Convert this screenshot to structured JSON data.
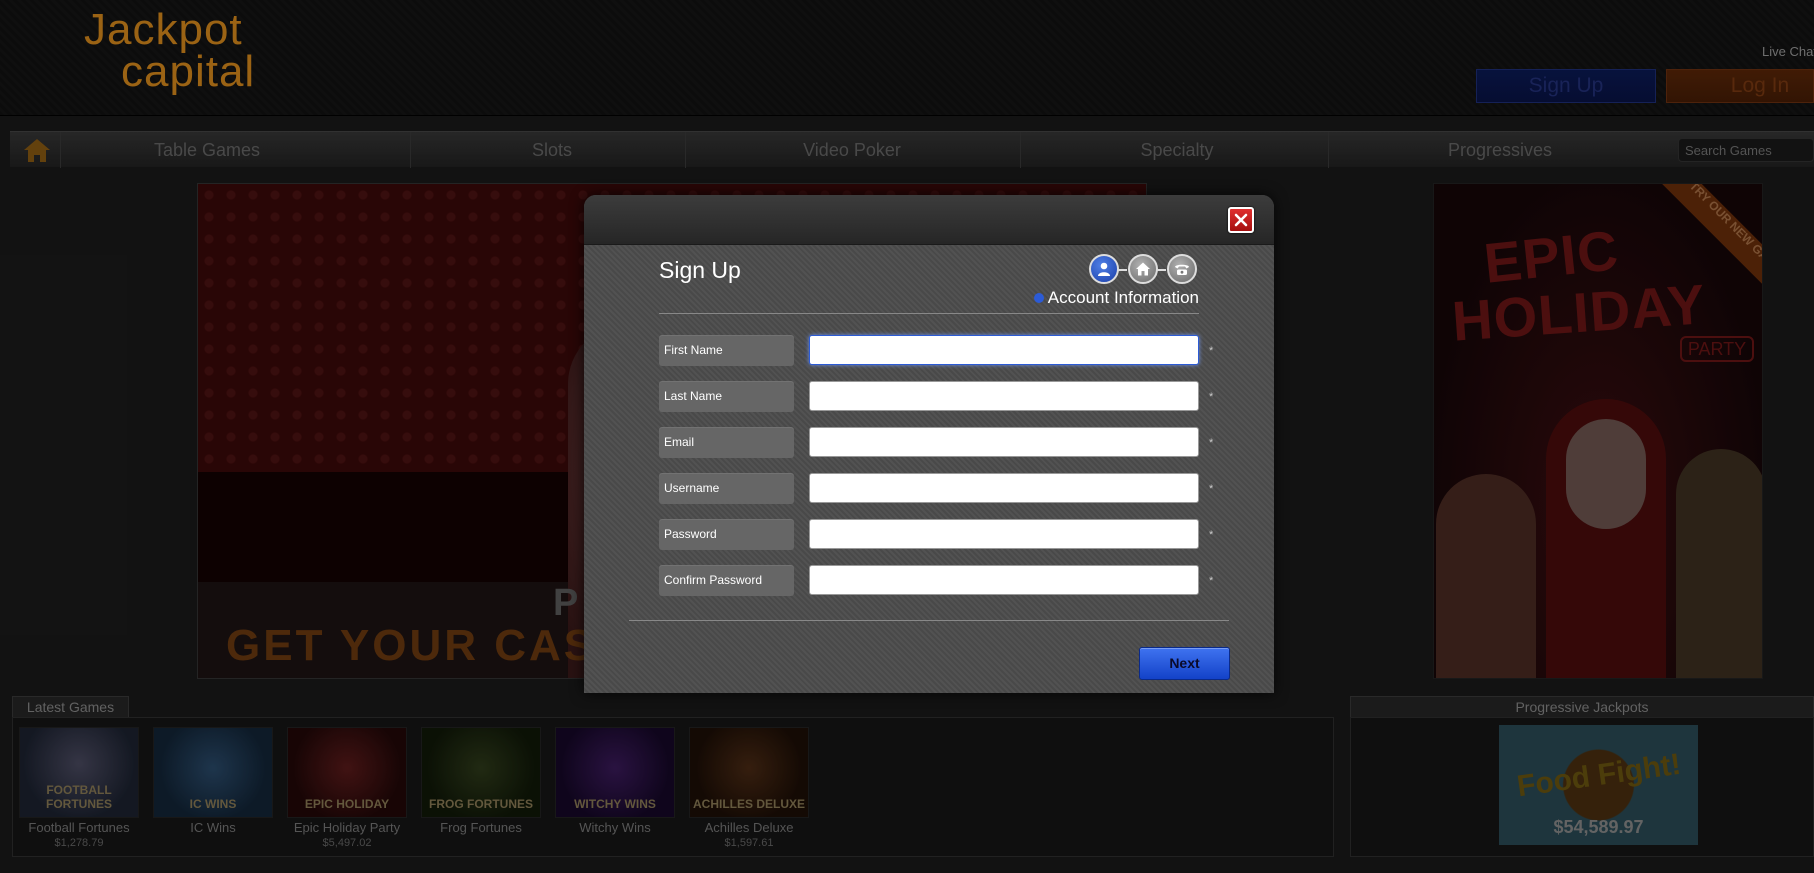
{
  "header": {
    "logo_line1": "Jackpot",
    "logo_line2": "capital",
    "live_chat": "Live Chat",
    "signup_label": "Sign Up",
    "login_label": "Log In"
  },
  "nav": {
    "items": [
      "Table Games",
      "Slots",
      "Video Poker",
      "Specialty",
      "Progressives"
    ],
    "search_placeholder": "Search Games"
  },
  "banner": {
    "line1": "P",
    "line2": "GET YOUR CAS"
  },
  "promo": {
    "ribbon": "TRY OUR NEW GAME!",
    "title_line1": "EPIC",
    "title_line2": "HOLIDAY",
    "subtitle": "PARTY"
  },
  "latest_games": {
    "tab_label": "Latest Games",
    "games": [
      {
        "name": "Football Fortunes",
        "amount": "$1,278.79",
        "thumb_label": "FOOTBALL FORTUNES"
      },
      {
        "name": "IC Wins",
        "amount": "",
        "thumb_label": "IC WINS"
      },
      {
        "name": "Epic Holiday Party",
        "amount": "$5,497.02",
        "thumb_label": "EPIC HOLIDAY"
      },
      {
        "name": "Frog Fortunes",
        "amount": "",
        "thumb_label": "FROG FORTUNES"
      },
      {
        "name": "Witchy Wins",
        "amount": "",
        "thumb_label": "WITCHY WINS"
      },
      {
        "name": "Achilles Deluxe",
        "amount": "$1,597.61",
        "thumb_label": "ACHILLES DELUXE"
      }
    ]
  },
  "progressive": {
    "tab_label": "Progressive Jackpots",
    "game_title": "Food Fight!",
    "amount": "$54,589.97"
  },
  "modal": {
    "title": "Sign Up",
    "step_label": "Account Information",
    "fields": [
      {
        "label": "First Name",
        "value": "",
        "placeholder": "",
        "required": "*"
      },
      {
        "label": "Last Name",
        "value": "",
        "placeholder": "",
        "required": "*"
      },
      {
        "label": "Email",
        "value": "",
        "placeholder": "",
        "required": "*"
      },
      {
        "label": "Username",
        "value": "",
        "placeholder": "",
        "required": "*"
      },
      {
        "label": "Password",
        "value": "",
        "placeholder": "",
        "required": "*"
      },
      {
        "label": "Confirm Password",
        "value": "",
        "placeholder": "",
        "required": "*"
      }
    ],
    "next_label": "Next",
    "step_icons": [
      "user-icon",
      "home-icon",
      "phone-icon"
    ]
  },
  "colors": {
    "brand_orange": "#d78a1c",
    "signup_blue": "#1b3ea8",
    "login_orange": "#c2561a",
    "accent_blue": "#2c5bd6",
    "close_red": "#c11b1b"
  }
}
